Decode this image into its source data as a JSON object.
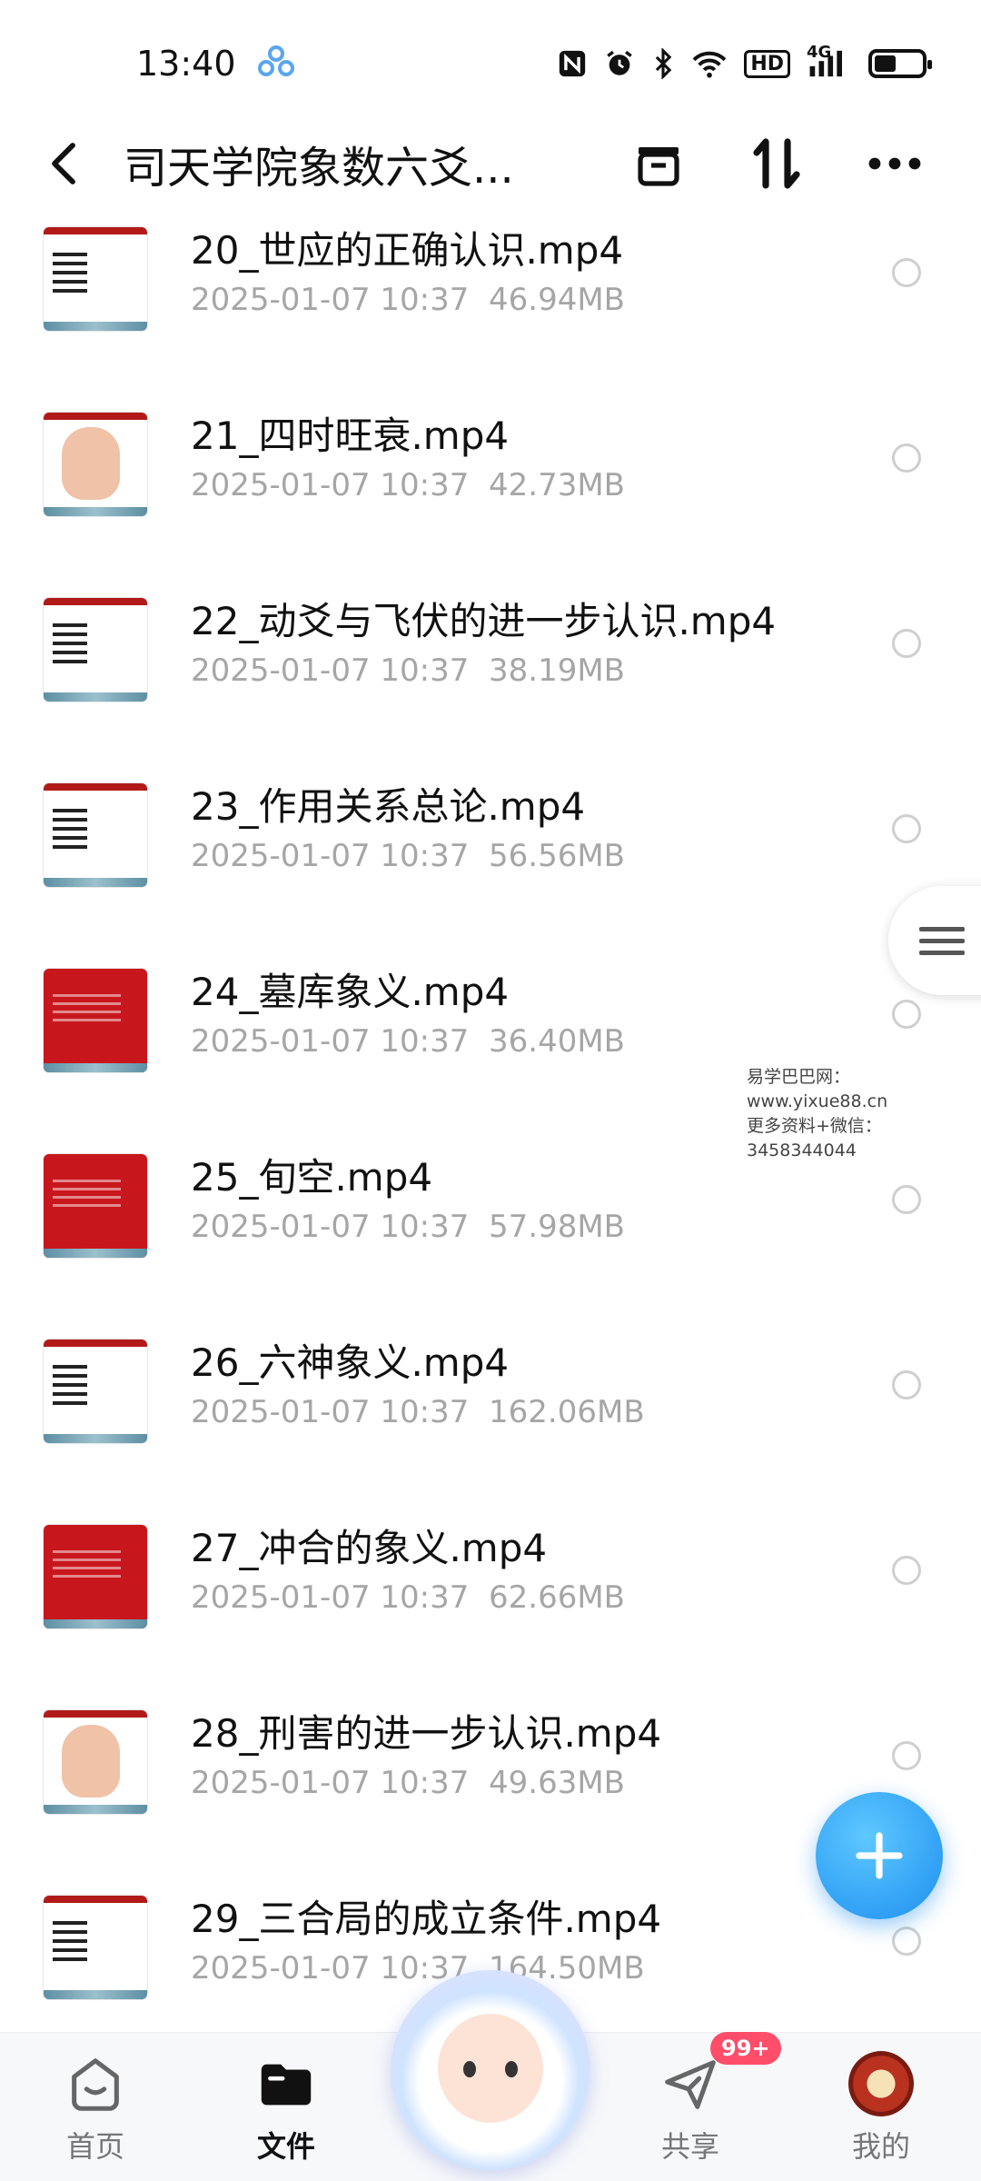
{
  "status_bar": {
    "time": "13:40",
    "icons": [
      "nfc-icon",
      "alarm-icon",
      "bluetooth-icon",
      "wifi-icon",
      "hd-icon",
      "signal-4g-icon",
      "battery-icon"
    ],
    "hd_label": "HD",
    "network_label": "4G",
    "battery_level": 0.45
  },
  "header": {
    "title": "司天学院象数六爻...",
    "back_icon": "chevron-left-icon",
    "actions": [
      "box-icon",
      "sort-icon",
      "more-icon"
    ]
  },
  "files": [
    {
      "name": "20_世应的正确认识.mp4",
      "date": "2025-01-07  10:37",
      "size": "46.94MB",
      "thumb": "white"
    },
    {
      "name": "21_四时旺衰.mp4",
      "date": "2025-01-07  10:37",
      "size": "42.73MB",
      "thumb": "hand"
    },
    {
      "name": "22_动爻与飞伏的进一步认识.mp4",
      "date": "2025-01-07  10:37",
      "size": "38.19MB",
      "thumb": "white"
    },
    {
      "name": "23_作用关系总论.mp4",
      "date": "2025-01-07  10:37",
      "size": "56.56MB",
      "thumb": "white"
    },
    {
      "name": "24_墓库象义.mp4",
      "date": "2025-01-07  10:37",
      "size": "36.40MB",
      "thumb": "red"
    },
    {
      "name": "25_旬空.mp4",
      "date": "2025-01-07  10:37",
      "size": "57.98MB",
      "thumb": "red"
    },
    {
      "name": "26_六神象义.mp4",
      "date": "2025-01-07  10:37",
      "size": "162.06MB",
      "thumb": "white"
    },
    {
      "name": "27_冲合的象义.mp4",
      "date": "2025-01-07  10:37",
      "size": "62.66MB",
      "thumb": "red"
    },
    {
      "name": "28_刑害的进一步认识.mp4",
      "date": "2025-01-07  10:37",
      "size": "49.63MB",
      "thumb": "hand"
    },
    {
      "name": "29_三合局的成立条件.mp4",
      "date": "2025-01-07  10:37",
      "size": "164.50MB",
      "thumb": "white"
    }
  ],
  "watermark": {
    "line1": "易学巴巴网：www.yixue88.cn",
    "line2": "更多资料+微信：3458344044"
  },
  "bottom_nav": {
    "items": [
      {
        "label": "首页",
        "icon": "home-icon",
        "active": false
      },
      {
        "label": "文件",
        "icon": "folder-icon",
        "active": true
      },
      {
        "label": "共享",
        "icon": "send-icon",
        "active": false
      },
      {
        "label": "我的",
        "icon": "avatar",
        "active": false
      }
    ],
    "share_badge": "99+"
  },
  "colors": {
    "accent": "#1e8ff0",
    "badge": "#ff4d6a",
    "meta_text": "#a6a6a6"
  }
}
